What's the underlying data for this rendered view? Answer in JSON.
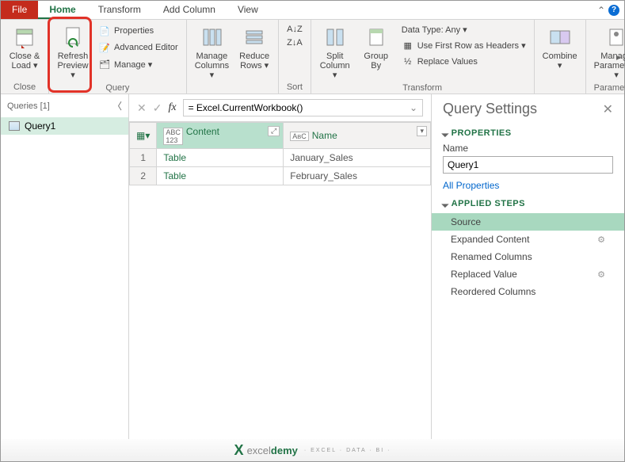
{
  "tabs": {
    "file": "File",
    "home": "Home",
    "transform": "Transform",
    "addcolumn": "Add Column",
    "view": "View"
  },
  "ribbon": {
    "close": {
      "label": "Close &\nLoad ▾",
      "group": "Close"
    },
    "refresh": {
      "label": "Refresh\nPreview ▾"
    },
    "properties": "Properties",
    "advanced": "Advanced Editor",
    "manage": "Manage ▾",
    "query_group": "Query",
    "manage_cols": {
      "label": "Manage\nColumns ▾"
    },
    "reduce_rows": {
      "label": "Reduce\nRows ▾"
    },
    "sort_group": "Sort",
    "split": {
      "label": "Split\nColumn ▾"
    },
    "groupby": {
      "label": "Group\nBy"
    },
    "datatype": "Data Type: Any ▾",
    "firstrow": "Use First Row as Headers ▾",
    "replace": "Replace Values",
    "transform_group": "Transform",
    "combine": {
      "label": "Combine\n▾"
    },
    "params": {
      "label": "Manage\nParameters ▾",
      "group": "Parameters"
    }
  },
  "queries": {
    "header": "Queries [1]",
    "items": [
      "Query1"
    ]
  },
  "formula": "= Excel.CurrentWorkbook()",
  "grid": {
    "columns": [
      "Content",
      "Name"
    ],
    "rows": [
      {
        "n": "1",
        "content": "Table",
        "name": "January_Sales"
      },
      {
        "n": "2",
        "content": "Table",
        "name": "February_Sales"
      }
    ]
  },
  "settings": {
    "title": "Query Settings",
    "properties": "PROPERTIES",
    "name_label": "Name",
    "name_value": "Query1",
    "all_props": "All Properties",
    "applied": "APPLIED STEPS",
    "steps": [
      "Source",
      "Expanded Content",
      "Renamed Columns",
      "Replaced Value",
      "Reordered Columns"
    ]
  },
  "footer": {
    "brand1": "excel",
    "brand2": "demy",
    "sub": "· EXCEL · DATA · BI ·"
  }
}
